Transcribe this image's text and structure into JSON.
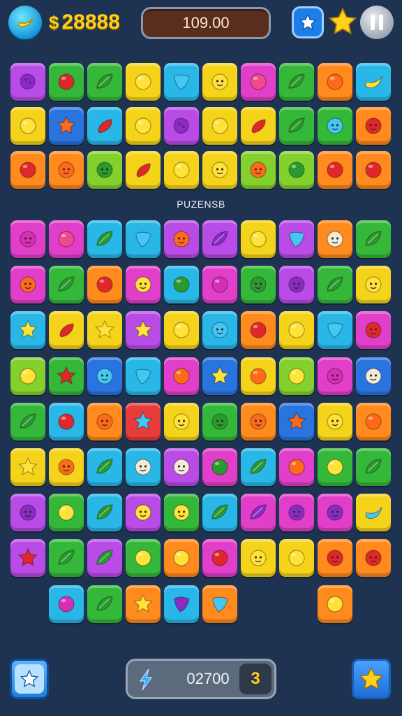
{
  "header": {
    "score": "28888",
    "currency_symbol": "$",
    "timer": "109.00",
    "coin_icon": "banana-coin-icon",
    "star_button_icon": "star-icon",
    "bonus_star_icon": "star-icon",
    "pause_icon": "pause-icon"
  },
  "mid_label": "PUZENSB",
  "footer": {
    "left_button_icon": "star-icon",
    "boost_value": "02700",
    "boost_count": "3",
    "right_button_icon": "star-icon"
  },
  "colors": {
    "background": "#1e3352",
    "score": "#ffd21a",
    "tile_purple": "#b94be6",
    "tile_magenta": "#e13fc9",
    "tile_green": "#35b83a",
    "tile_lime": "#84d12d",
    "tile_yellow": "#f5d31b",
    "tile_orange": "#ff8a1d",
    "tile_red": "#e83c3c",
    "tile_cyan": "#29b7e8",
    "tile_blue": "#2a74e0"
  },
  "board_top": [
    [
      [
        "purple",
        "purple",
        "blob"
      ],
      [
        "green",
        "red",
        "round"
      ],
      [
        "green",
        "green",
        "leaf"
      ],
      [
        "yellow",
        "yellow",
        "round"
      ],
      [
        "cyan",
        "cyan",
        "drop"
      ],
      [
        "yellow",
        "yellow",
        "face"
      ],
      [
        "magenta",
        "pink",
        "round"
      ],
      [
        "green",
        "green",
        "leaf"
      ],
      [
        "orange",
        "orange",
        "round"
      ],
      [
        "cyan",
        "yellow",
        "banana"
      ]
    ],
    [
      [
        "yellow",
        "yellow",
        "round"
      ],
      [
        "blue",
        "orange",
        "star"
      ],
      [
        "cyan",
        "red",
        "pepper"
      ],
      [
        "yellow",
        "yellow",
        "round"
      ],
      [
        "purple",
        "purple",
        "blob"
      ],
      [
        "yellow",
        "yellow",
        "round"
      ],
      [
        "yellow",
        "red",
        "pepper"
      ],
      [
        "green",
        "green",
        "leaf"
      ],
      [
        "green",
        "cyan",
        "face"
      ],
      [
        "orange",
        "red",
        "face"
      ]
    ],
    [
      [
        "orange",
        "red",
        "round"
      ],
      [
        "orange",
        "orange",
        "face"
      ],
      [
        "lime",
        "green",
        "face"
      ],
      [
        "yellow",
        "red",
        "pepper"
      ],
      [
        "yellow",
        "yellow",
        "round"
      ],
      [
        "yellow",
        "yellow",
        "face"
      ],
      [
        "lime",
        "orange",
        "face"
      ],
      [
        "lime",
        "green",
        "round"
      ],
      [
        "orange",
        "red",
        "round"
      ],
      [
        "orange",
        "red",
        "round"
      ]
    ]
  ],
  "board_bottom": [
    [
      [
        "magenta",
        "magenta",
        "face"
      ],
      [
        "magenta",
        "pink",
        "round"
      ],
      [
        "cyan",
        "green",
        "leaf"
      ],
      [
        "cyan",
        "cyan",
        "drop"
      ],
      [
        "purple",
        "orange",
        "face"
      ],
      [
        "purple",
        "purple",
        "leaf"
      ],
      [
        "yellow",
        "yellow",
        "round"
      ],
      [
        "purple",
        "cyan",
        "drop"
      ],
      [
        "orange",
        "white",
        "face"
      ],
      [
        "green",
        "green",
        "leaf"
      ]
    ],
    [
      [
        "magenta",
        "orange",
        "face"
      ],
      [
        "green",
        "green",
        "leaf"
      ],
      [
        "orange",
        "red",
        "round"
      ],
      [
        "magenta",
        "yellow",
        "face"
      ],
      [
        "cyan",
        "green",
        "round"
      ],
      [
        "magenta",
        "magenta",
        "round"
      ],
      [
        "green",
        "green",
        "face"
      ],
      [
        "purple",
        "purple",
        "face"
      ],
      [
        "green",
        "green",
        "leaf"
      ],
      [
        "yellow",
        "yellow",
        "face"
      ]
    ],
    [
      [
        "cyan",
        "yellow",
        "star"
      ],
      [
        "yellow",
        "red",
        "pepper"
      ],
      [
        "yellow",
        "yellow",
        "star"
      ],
      [
        "purple",
        "yellow",
        "star"
      ],
      [
        "yellow",
        "yellow",
        "round"
      ],
      [
        "cyan",
        "cyan",
        "face"
      ],
      [
        "orange",
        "red",
        "round"
      ],
      [
        "yellow",
        "yellow",
        "round"
      ],
      [
        "cyan",
        "cyan",
        "drop"
      ],
      [
        "magenta",
        "red",
        "face"
      ]
    ],
    [
      [
        "lime",
        "yellow",
        "round"
      ],
      [
        "green",
        "red",
        "star"
      ],
      [
        "blue",
        "cyan",
        "face"
      ],
      [
        "cyan",
        "cyan",
        "drop"
      ],
      [
        "magenta",
        "orange",
        "round"
      ],
      [
        "blue",
        "yellow",
        "star"
      ],
      [
        "yellow",
        "orange",
        "round"
      ],
      [
        "lime",
        "yellow",
        "round"
      ],
      [
        "magenta",
        "magenta",
        "face"
      ],
      [
        "blue",
        "white",
        "face"
      ]
    ],
    [
      [
        "green",
        "green",
        "leaf"
      ],
      [
        "cyan",
        "red",
        "round"
      ],
      [
        "orange",
        "orange",
        "face"
      ],
      [
        "red",
        "cyan",
        "star"
      ],
      [
        "yellow",
        "yellow",
        "face"
      ],
      [
        "green",
        "green",
        "face"
      ],
      [
        "orange",
        "orange",
        "face"
      ],
      [
        "blue",
        "orange",
        "star"
      ],
      [
        "yellow",
        "yellow",
        "face"
      ],
      [
        "orange",
        "orange",
        "round"
      ]
    ],
    [
      [
        "yellow",
        "yellow",
        "star"
      ],
      [
        "yellow",
        "orange",
        "face"
      ],
      [
        "cyan",
        "green",
        "leaf"
      ],
      [
        "cyan",
        "white",
        "face"
      ],
      [
        "purple",
        "white",
        "face"
      ],
      [
        "magenta",
        "green",
        "round"
      ],
      [
        "cyan",
        "green",
        "leaf"
      ],
      [
        "magenta",
        "orange",
        "round"
      ],
      [
        "green",
        "yellow",
        "round"
      ],
      [
        "green",
        "green",
        "leaf"
      ]
    ],
    [
      [
        "purple",
        "purple",
        "face"
      ],
      [
        "green",
        "yellow",
        "round"
      ],
      [
        "cyan",
        "green",
        "leaf"
      ],
      [
        "purple",
        "yellow",
        "face"
      ],
      [
        "green",
        "yellow",
        "face"
      ],
      [
        "cyan",
        "green",
        "leaf"
      ],
      [
        "magenta",
        "purple",
        "leaf"
      ],
      [
        "magenta",
        "purple",
        "face"
      ],
      [
        "magenta",
        "purple",
        "face"
      ],
      [
        "yellow",
        "cyan",
        "banana"
      ]
    ],
    [
      [
        "purple",
        "red",
        "star"
      ],
      [
        "green",
        "green",
        "leaf"
      ],
      [
        "purple",
        "green",
        "leaf"
      ],
      [
        "green",
        "yellow",
        "round"
      ],
      [
        "orange",
        "yellow",
        "round"
      ],
      [
        "magenta",
        "red",
        "round"
      ],
      [
        "yellow",
        "yellow",
        "face"
      ],
      [
        "yellow",
        "yellow",
        "round"
      ],
      [
        "orange",
        "red",
        "face"
      ],
      [
        "orange",
        "red",
        "face"
      ]
    ],
    [
      null,
      [
        "cyan",
        "magenta",
        "round"
      ],
      [
        "green",
        "green",
        "leaf"
      ],
      [
        "orange",
        "yellow",
        "star"
      ],
      [
        "cyan",
        "purple",
        "drop"
      ],
      [
        "orange",
        "cyan",
        "drop"
      ],
      null,
      null,
      [
        "orange",
        "yellow",
        "round"
      ],
      null
    ]
  ]
}
